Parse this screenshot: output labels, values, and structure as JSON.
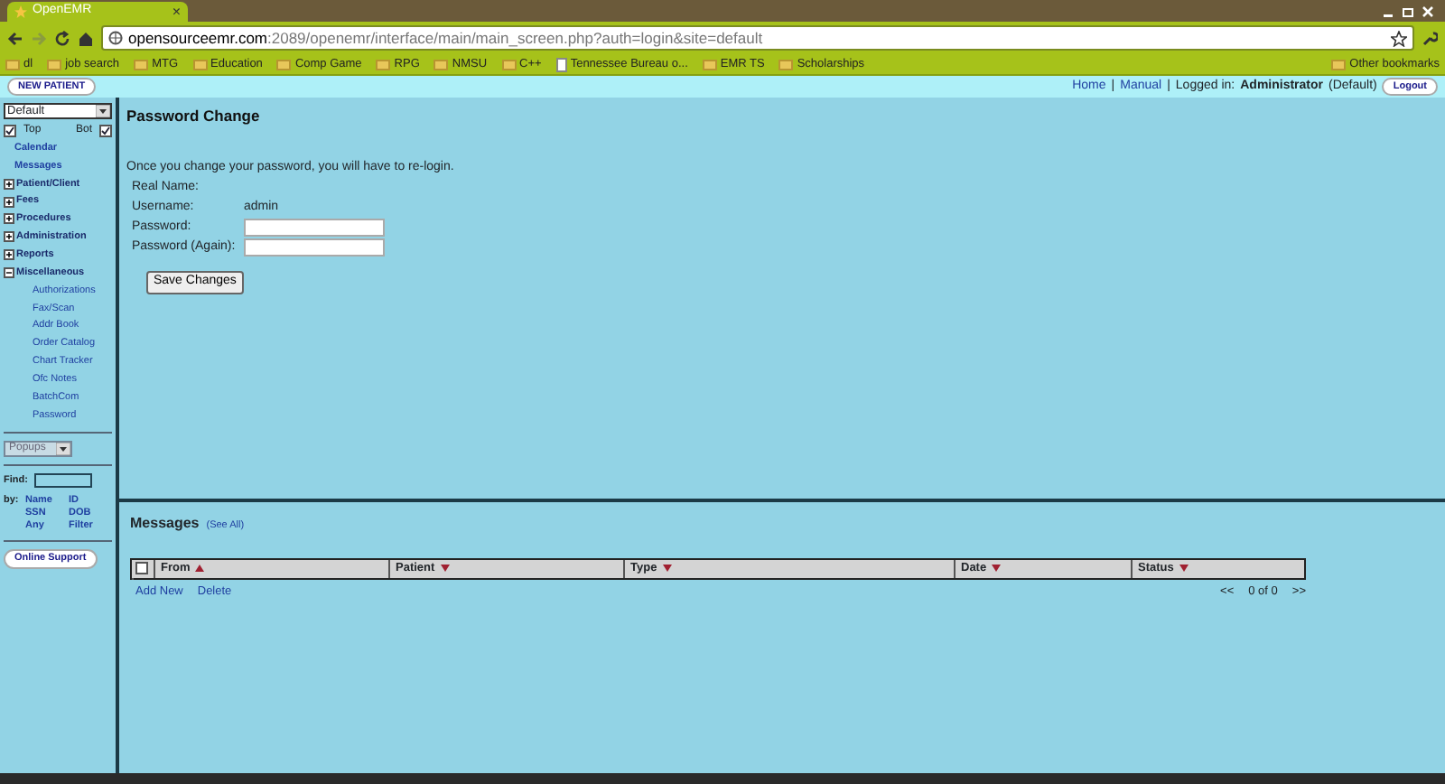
{
  "browser": {
    "tab": {
      "title": "OpenEMR",
      "close": "×"
    },
    "address": {
      "host": "opensourceemr.com",
      "path": ":2089/openemr/interface/main/main_screen.php?auth=login&site=default"
    },
    "bookmarks": [
      {
        "label": "dl",
        "kind": "folder"
      },
      {
        "label": "job search",
        "kind": "folder"
      },
      {
        "label": "MTG",
        "kind": "folder"
      },
      {
        "label": "Education",
        "kind": "folder"
      },
      {
        "label": "Comp Game",
        "kind": "folder"
      },
      {
        "label": "RPG",
        "kind": "folder"
      },
      {
        "label": "NMSU",
        "kind": "folder"
      },
      {
        "label": "C++",
        "kind": "folder"
      },
      {
        "label": "Tennessee Bureau o...",
        "kind": "page"
      },
      {
        "label": "EMR TS",
        "kind": "folder"
      },
      {
        "label": "Scholarships",
        "kind": "folder"
      }
    ],
    "other_bookmarks": "Other bookmarks"
  },
  "header": {
    "new_patient": "NEW PATIENT",
    "links": [
      "Home",
      "Manual"
    ],
    "separator": "|",
    "logged_in_label": "Logged in:",
    "user": "Administrator",
    "user_note": "(Default)",
    "logout": "Logout"
  },
  "sidebar": {
    "layout_select": "Default",
    "top": {
      "label": "Top",
      "checked": true
    },
    "bot": {
      "label": "Bot",
      "checked": true
    },
    "menu": [
      {
        "label": "Calendar",
        "kind": "link"
      },
      {
        "label": "Messages",
        "kind": "link"
      },
      {
        "label": "Patient/Client",
        "kind": "group",
        "expanded": false
      },
      {
        "label": "Fees",
        "kind": "group",
        "expanded": false
      },
      {
        "label": "Procedures",
        "kind": "group",
        "expanded": false
      },
      {
        "label": "Administration",
        "kind": "group",
        "expanded": false
      },
      {
        "label": "Reports",
        "kind": "group",
        "expanded": false
      },
      {
        "label": "Miscellaneous",
        "kind": "group",
        "expanded": true,
        "children": [
          {
            "label": "Authorizations"
          },
          {
            "label": "Fax/Scan"
          },
          {
            "label": "Addr Book"
          },
          {
            "label": "Order Catalog"
          },
          {
            "label": "Chart Tracker"
          },
          {
            "label": "Ofc Notes"
          },
          {
            "label": "BatchCom"
          },
          {
            "label": "Password"
          }
        ]
      }
    ],
    "popups": "Popups",
    "find_label": "Find:",
    "by_label": "by:",
    "find_by": [
      [
        "Name",
        "ID"
      ],
      [
        "SSN",
        "DOB"
      ],
      [
        "Any",
        "Filter"
      ]
    ],
    "online_support": "Online Support"
  },
  "password_change": {
    "title": "Password Change",
    "notice": "Once you change your password, you will have to re-login.",
    "fields": [
      {
        "label": "Real Name:",
        "kind": "text"
      },
      {
        "label": "Username:",
        "kind": "text",
        "value": "admin"
      },
      {
        "label": "Password:",
        "kind": "input"
      },
      {
        "label": "Password (Again):",
        "kind": "input"
      }
    ],
    "save": "Save Changes"
  },
  "messages": {
    "title": "Messages",
    "see_all": "(See All)",
    "select_all": {
      "checked": false
    },
    "columns": [
      {
        "label": "From",
        "sorted": true
      },
      {
        "label": "Patient",
        "sorted": false
      },
      {
        "label": "Type",
        "sorted": false
      },
      {
        "label": "Date",
        "sorted": false
      },
      {
        "label": "Status",
        "sorted": false
      }
    ],
    "actions": [
      "Add New",
      "Delete"
    ],
    "pager": {
      "prev": "<<",
      "count": "0 of 0",
      "next": ">>"
    }
  }
}
